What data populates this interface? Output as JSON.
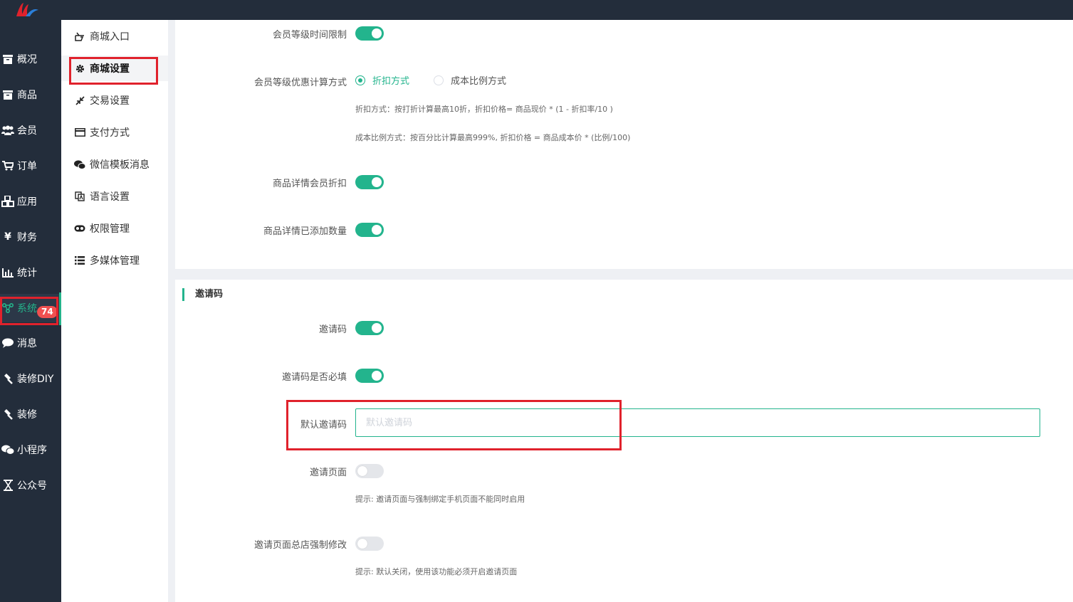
{
  "sidebar": {
    "items": [
      {
        "label": "概况",
        "icon": "archive-icon"
      },
      {
        "label": "商品",
        "icon": "archive-icon"
      },
      {
        "label": "会员",
        "icon": "users-icon"
      },
      {
        "label": "订单",
        "icon": "cart-icon"
      },
      {
        "label": "应用",
        "icon": "cubes-icon"
      },
      {
        "label": "财务",
        "icon": "yen-icon"
      },
      {
        "label": "统计",
        "icon": "bar-chart-icon"
      },
      {
        "label": "系统",
        "icon": "network-icon"
      },
      {
        "label": "消息",
        "icon": "chat-bubble-icon"
      },
      {
        "label": "装修DIY",
        "icon": "hammer-icon"
      },
      {
        "label": "装修",
        "icon": "hammer-icon"
      },
      {
        "label": "小程序",
        "icon": "wechat-icon"
      },
      {
        "label": "公众号",
        "icon": "hourglass-icon"
      }
    ],
    "message_badge": "74",
    "active_color": "#24b38a"
  },
  "subnav": {
    "items": [
      {
        "label": "商城入口",
        "icon": "hand-pointer-icon"
      },
      {
        "label": "商城设置",
        "icon": "gear-icon"
      },
      {
        "label": "交易设置",
        "icon": "compress-icon"
      },
      {
        "label": "支付方式",
        "icon": "credit-card-icon"
      },
      {
        "label": "微信模板消息",
        "icon": "wechat-icon"
      },
      {
        "label": "语言设置",
        "icon": "language-icon"
      },
      {
        "label": "权限管理",
        "icon": "mask-icon"
      },
      {
        "label": "多媒体管理",
        "icon": "list-icon"
      }
    ]
  },
  "member": {
    "time_limit_label": "会员等级时间限制",
    "discount_calc_label": "会员等级优惠计算方式",
    "radio_discount": "折扣方式",
    "radio_cost": "成本比例方式",
    "hint_discount": "折扣方式：按打折计算最高10折，折扣价格= 商品现价 * (1 - 折扣率/10 )",
    "hint_cost": "成本比例方式：按百分比计算最高999%, 折扣价格 = 商品成本价 * (比例/100)",
    "detail_discount_label": "商品详情会员折扣",
    "detail_added_label": "商品详情已添加数量"
  },
  "invite": {
    "section_title": "邀请码",
    "code_label": "邀请码",
    "required_label": "邀请码是否必填",
    "default_label": "默认邀请码",
    "default_placeholder": "默认邀请码",
    "default_value": "",
    "page_label": "邀请页面",
    "page_hint": "提示:   邀请页面与强制绑定手机页面不能同时启用",
    "force_label": "邀请页面总店强制修改",
    "force_hint": "提示:   默认关闭，使用该功能必须开启邀请页面"
  },
  "colors": {
    "accent": "#23b48d",
    "highlight": "#e0222c",
    "sidebar_bg": "#232d3b"
  }
}
